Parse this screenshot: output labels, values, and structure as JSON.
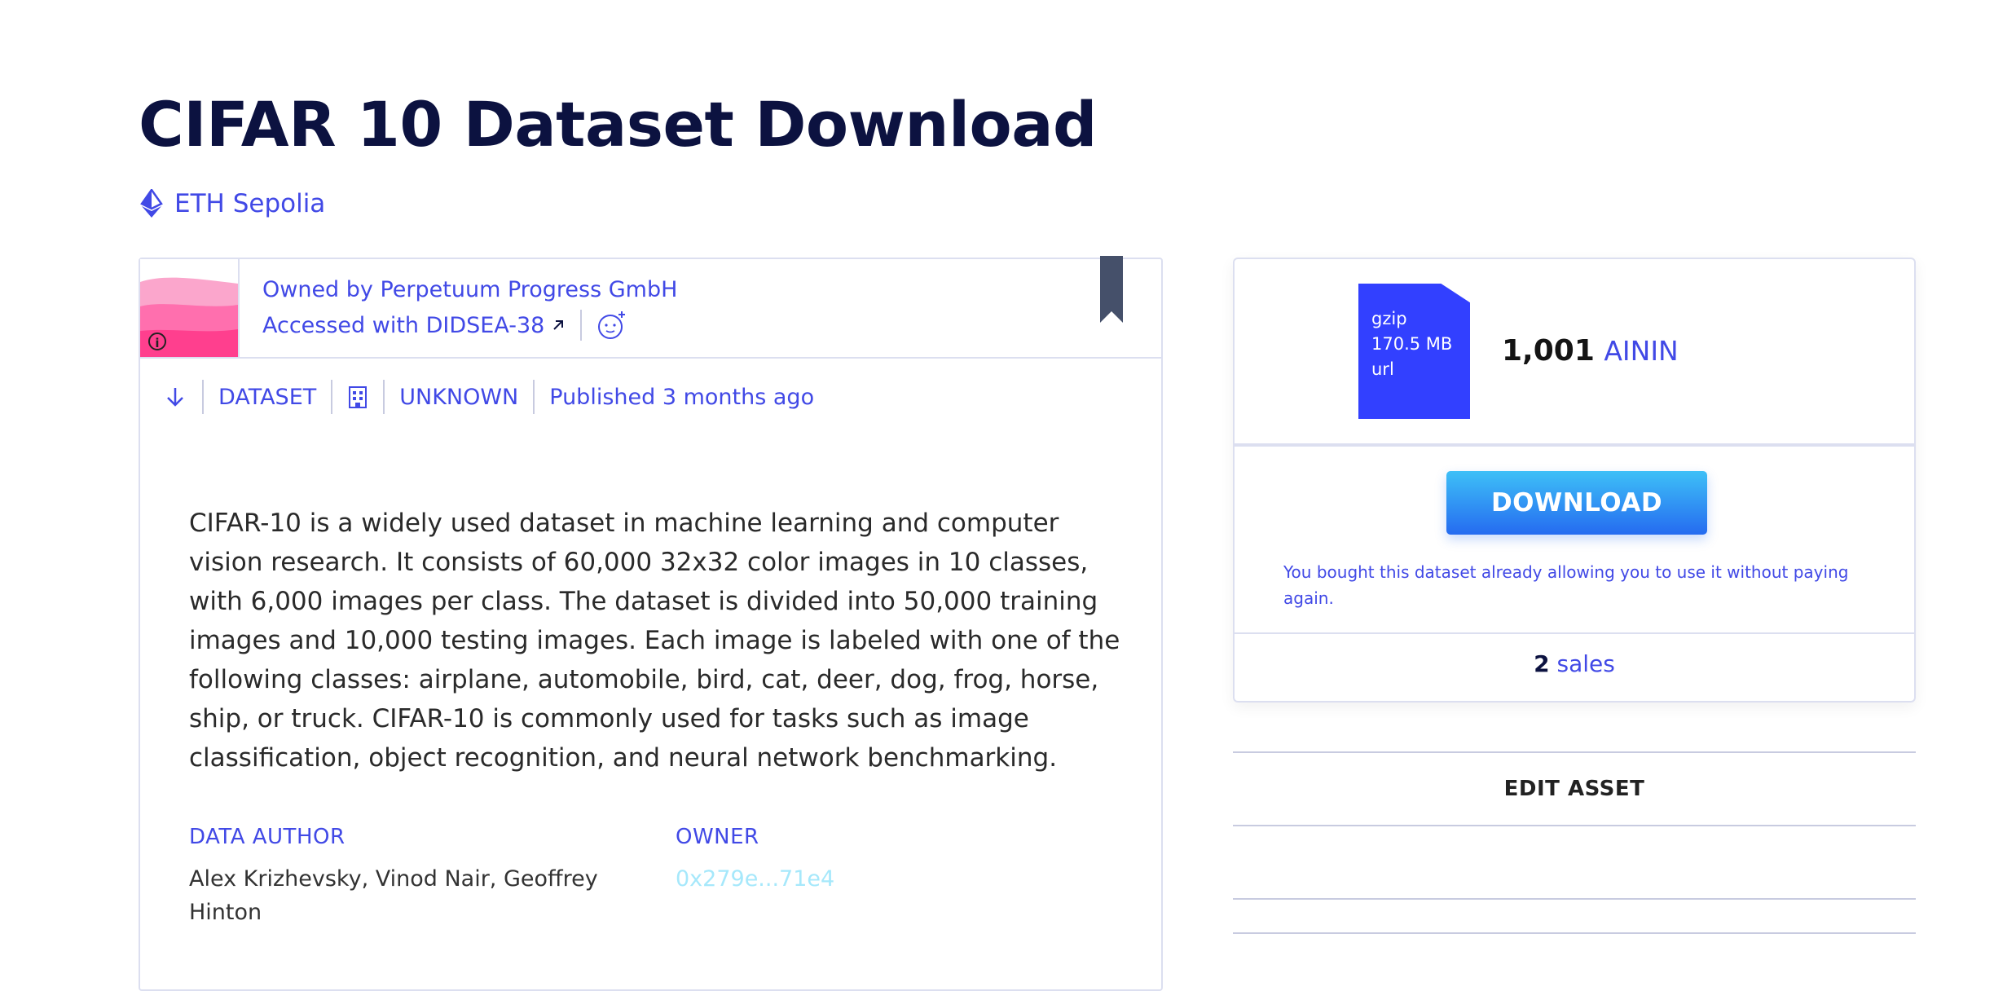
{
  "page": {
    "title": "CIFAR 10 Dataset Download"
  },
  "network": {
    "icon": "ethereum-icon",
    "label": "ETH Sepolia"
  },
  "owner_bar": {
    "owned_by": "Owned by Perpetuum Progress GmbH",
    "accessed_with": "Accessed with DIDSEA-38",
    "external_icon": "arrow-up-right-icon",
    "smiley_icon": "add-emoji-icon",
    "bookmark_icon": "bookmark-icon"
  },
  "meta": {
    "download_icon": "arrow-down-icon",
    "type": "DATASET",
    "compute_icon": "building-icon",
    "access": "UNKNOWN",
    "published": "Published 3 months ago"
  },
  "description": "CIFAR-10 is a widely used dataset in machine learning and computer vision research. It consists of 60,000 32x32 color images in 10 classes, with 6,000 images per class. The dataset is divided into 50,000 training images and 10,000 testing images. Each image is labeled with one of the following classes: airplane, automobile, bird, cat, deer, dog, frog, horse, ship, or truck. CIFAR-10 is commonly used for tasks such as image classification, object recognition, and neural network benchmarking.",
  "details": {
    "author_label": "DATA AUTHOR",
    "author_value": "Alex Krizhevsky, Vinod Nair, Geoffrey Hinton",
    "owner_label": "OWNER",
    "owner_value": "0x279e...71e4"
  },
  "purchase": {
    "file": {
      "compression": "gzip",
      "size": "170.5 MB",
      "type": "url"
    },
    "price": "1,001",
    "currency": "AININ",
    "download_label": "DOWNLOAD",
    "bought_note": "You bought this dataset already allowing you to use it without paying again.",
    "sales_count": "2",
    "sales_word": "sales"
  },
  "edit_asset": "EDIT ASSET",
  "colors": {
    "accent": "#4149e6",
    "title": "#0c1240",
    "file": "#3240ff",
    "owner_address": "#a6e8fb",
    "avatar": "#ff3f8e"
  }
}
